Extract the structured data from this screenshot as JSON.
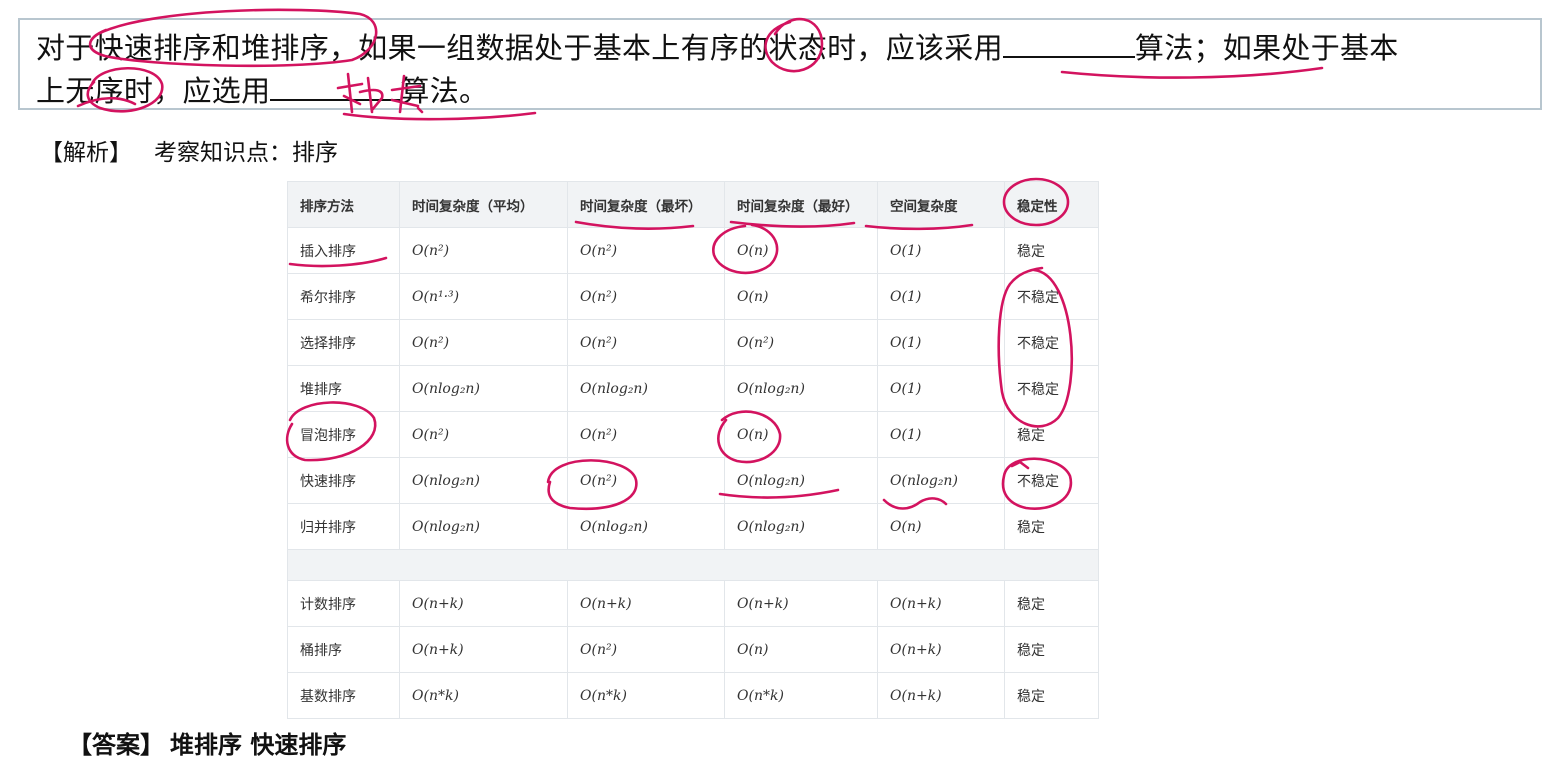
{
  "question": {
    "line1_part1": "对于快速排序和堆排序，如果一组数据处于基本上有序的状态时，应该采用",
    "line1_part2": "算法；如果处于基本",
    "line2_part1": "上无序时，应选用",
    "line2_part2": "算法。"
  },
  "analysis": {
    "label": "【解析】",
    "text": "考察知识点：排序"
  },
  "table": {
    "headers": [
      "排序方法",
      "时间复杂度（平均）",
      "时间复杂度（最坏）",
      "时间复杂度（最好）",
      "空间复杂度",
      "稳定性"
    ],
    "rows": [
      [
        "插入排序",
        "O(n²)",
        "O(n²)",
        "O(n)",
        "O(1)",
        "稳定"
      ],
      [
        "希尔排序",
        "O(n¹·³)",
        "O(n²)",
        "O(n)",
        "O(1)",
        "不稳定"
      ],
      [
        "选择排序",
        "O(n²)",
        "O(n²)",
        "O(n²)",
        "O(1)",
        "不稳定"
      ],
      [
        "堆排序",
        "O(nlog₂n)",
        "O(nlog₂n)",
        "O(nlog₂n)",
        "O(1)",
        "不稳定"
      ],
      [
        "冒泡排序",
        "O(n²)",
        "O(n²)",
        "O(n)",
        "O(1)",
        "稳定"
      ],
      [
        "快速排序",
        "O(nlog₂n)",
        "O(n²)",
        "O(nlog₂n)",
        "O(nlog₂n)",
        "不稳定"
      ],
      [
        "归并排序",
        "O(nlog₂n)",
        "O(nlog₂n)",
        "O(nlog₂n)",
        "O(n)",
        "稳定"
      ]
    ],
    "rows2": [
      [
        "计数排序",
        "O(n+k)",
        "O(n+k)",
        "O(n+k)",
        "O(n+k)",
        "稳定"
      ],
      [
        "桶排序",
        "O(n+k)",
        "O(n²)",
        "O(n)",
        "O(n+k)",
        "稳定"
      ],
      [
        "基数排序",
        "O(n*k)",
        "O(n*k)",
        "O(n*k)",
        "O(n+k)",
        "稳定"
      ]
    ]
  },
  "answer": {
    "label": "【答案】",
    "text": "堆排序 快速排序"
  },
  "annotation_color": "#d3135f"
}
